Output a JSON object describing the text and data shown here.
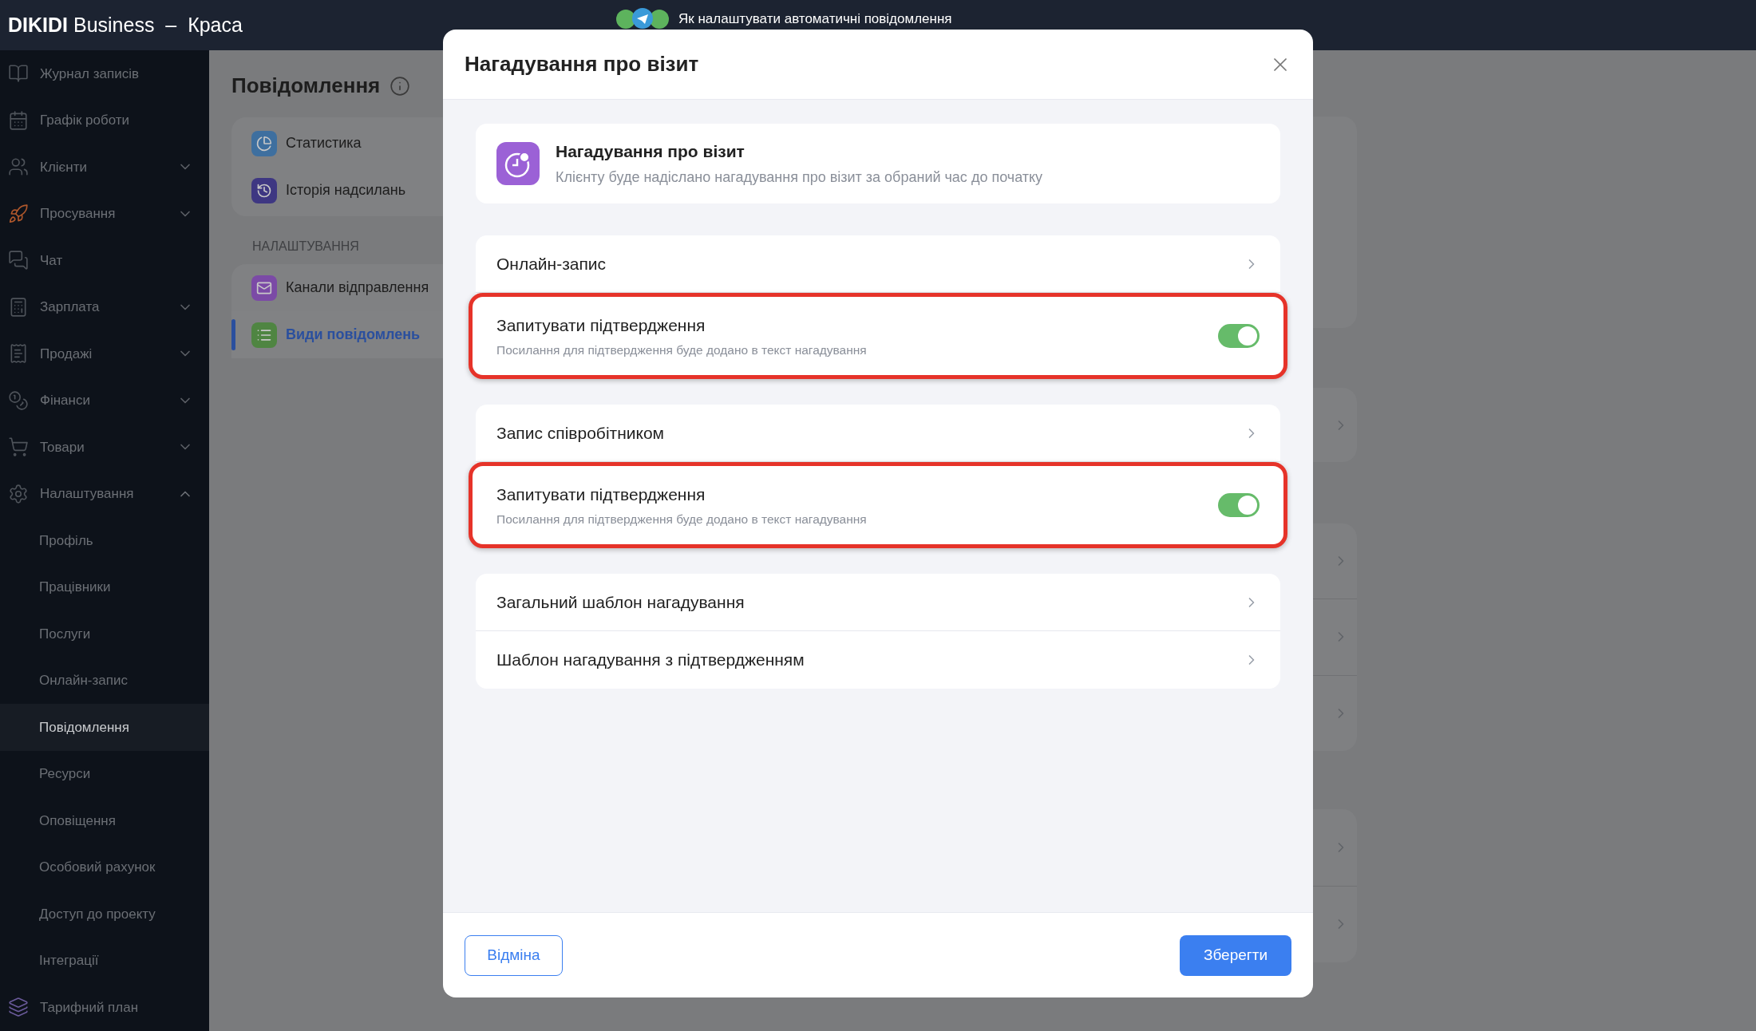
{
  "app_bar": {
    "brand": "DIKIDI",
    "product": "Business",
    "separator": "–",
    "workspace": "Краса",
    "help_banner": "Як налаштувати автоматичні повідомлення"
  },
  "sidebar": {
    "items": [
      {
        "label": "Журнал записів",
        "kind": "link",
        "selected": false
      },
      {
        "label": "Графік роботи",
        "kind": "link",
        "selected": false
      },
      {
        "label": "Клієнти",
        "kind": "group",
        "expanded": false,
        "selected": false
      },
      {
        "label": "Просування",
        "kind": "group",
        "expanded": false,
        "selected": false
      },
      {
        "label": "Чат",
        "kind": "link",
        "selected": false
      },
      {
        "label": "Зарплата",
        "kind": "group",
        "expanded": false,
        "selected": false
      },
      {
        "label": "Продажі",
        "kind": "group",
        "expanded": false,
        "selected": false
      },
      {
        "label": "Фінанси",
        "kind": "group",
        "expanded": false,
        "selected": false
      },
      {
        "label": "Товари",
        "kind": "group",
        "expanded": false,
        "selected": false
      },
      {
        "label": "Налаштування",
        "kind": "group",
        "expanded": true,
        "selected": false,
        "children": [
          {
            "label": "Профіль",
            "selected": false
          },
          {
            "label": "Працівники",
            "selected": false
          },
          {
            "label": "Послуги",
            "selected": false
          },
          {
            "label": "Онлайн-запис",
            "selected": false
          },
          {
            "label": "Повідомлення",
            "selected": true
          },
          {
            "label": "Ресурси",
            "selected": false
          },
          {
            "label": "Оповіщення",
            "selected": false
          },
          {
            "label": "Особовий рахунок",
            "selected": false
          },
          {
            "label": "Доступ до проекту",
            "selected": false
          },
          {
            "label": "Інтеграції",
            "selected": false
          }
        ]
      },
      {
        "label": "Тарифний план",
        "kind": "link",
        "selected": false
      }
    ]
  },
  "page": {
    "title": "Повідомлення",
    "menu": [
      {
        "label": "Статистика",
        "selected": false
      },
      {
        "label": "Історія надсилань",
        "selected": false
      }
    ],
    "settings_heading": "НАЛАШТУВАННЯ",
    "settings_menu": [
      {
        "label": "Канали відправлення",
        "selected": false
      },
      {
        "label": "Види повідомлень",
        "selected": true
      }
    ]
  },
  "modal": {
    "title": "Нагадування про візит",
    "info": {
      "title": "Нагадування про візит",
      "description": "Клієнту буде надіслано нагадування про візит за обраний час до початку"
    },
    "sections": [
      {
        "rows": [
          {
            "kind": "link",
            "label": "Онлайн-запис"
          },
          {
            "kind": "toggle",
            "label": "Запитувати підтвердження",
            "description": "Посилання для підтвердження буде додано в текст нагадування",
            "on": true,
            "highlighted": true
          }
        ]
      },
      {
        "rows": [
          {
            "kind": "link",
            "label": "Запис співробітником"
          },
          {
            "kind": "toggle",
            "label": "Запитувати підтвердження",
            "description": "Посилання для підтвердження буде додано в текст нагадування",
            "on": true,
            "highlighted": true
          }
        ]
      },
      {
        "rows": [
          {
            "kind": "link",
            "label": "Загальний шаблон нагадування"
          },
          {
            "kind": "link",
            "label": "Шаблон нагадування з підтвердженням"
          }
        ]
      }
    ],
    "cancel_button": "Відміна",
    "save_button": "Зберегти"
  }
}
